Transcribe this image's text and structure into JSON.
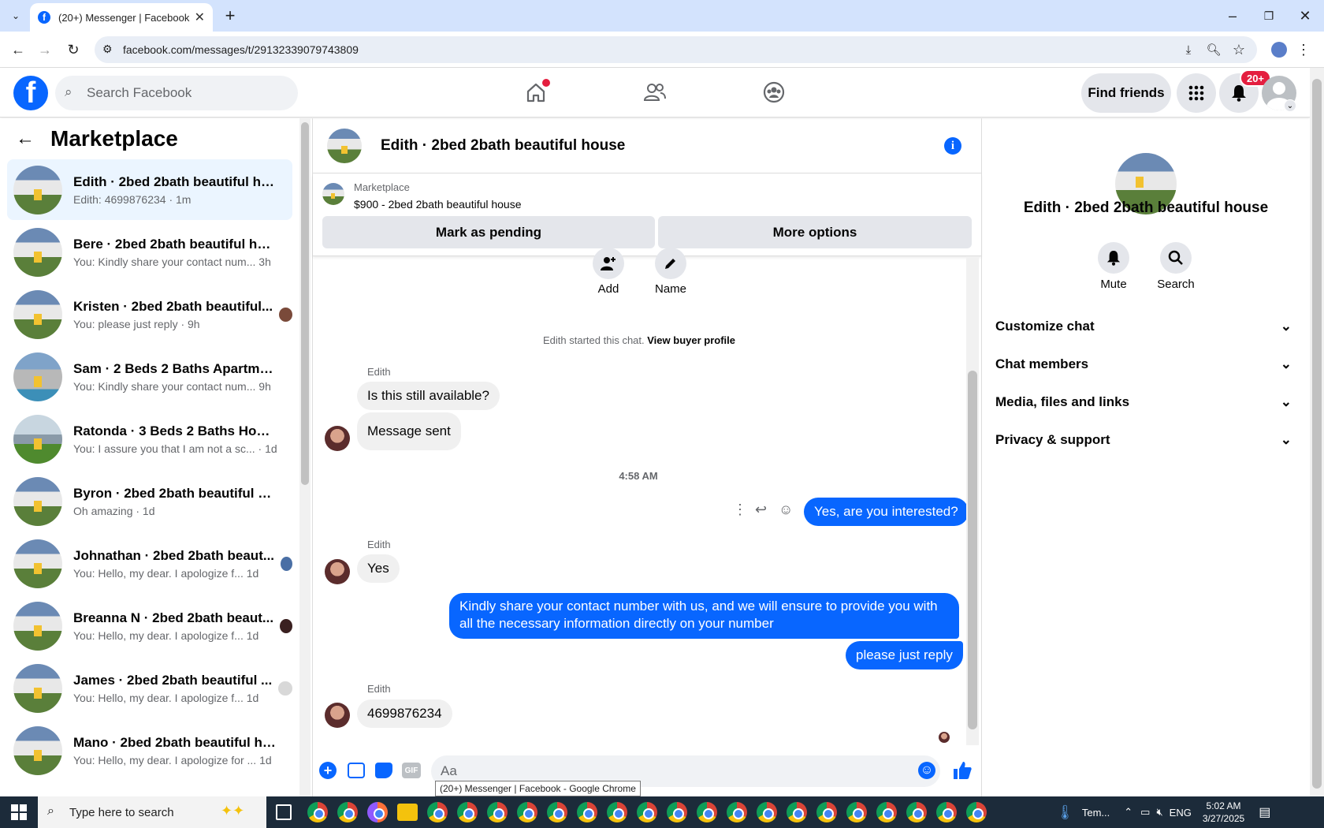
{
  "browser": {
    "tab_title": "(20+) Messenger | Facebook",
    "url": "facebook.com/messages/t/29132339079743809",
    "new_tab": "+"
  },
  "facebook": {
    "logo": "f",
    "search_placeholder": "Search Facebook",
    "find_friends": "Find friends",
    "notification_badge": "20+"
  },
  "sidebar": {
    "title": "Marketplace",
    "conversations": [
      {
        "name": "Edith · 2bed 2bath beautiful hou...",
        "preview": "Edith: 4699876234 · 1m",
        "time": ""
      },
      {
        "name": "Bere · 2bed 2bath beautiful house",
        "preview": "You: Kindly share your contact num...",
        "time": "3h"
      },
      {
        "name": "Kristen · 2bed 2bath beautiful...",
        "preview": "You: please just reply · 9h",
        "time": ""
      },
      {
        "name": "Sam · 2 Beds 2 Baths Apartment...",
        "preview": "You: Kindly share your contact num...",
        "time": "9h"
      },
      {
        "name": "Ratonda · 3 Beds 2 Baths House",
        "preview": "You: I assure you that I am not a sc...",
        "time": "· 1d"
      },
      {
        "name": "Byron · 2bed 2bath beautiful ho...",
        "preview": "Oh amazing · 1d",
        "time": ""
      },
      {
        "name": "Johnathan · 2bed 2bath beaut...",
        "preview": "You: Hello, my dear. I apologize f...",
        "time": "1d"
      },
      {
        "name": "Breanna N · 2bed 2bath beaut...",
        "preview": "You: Hello, my dear. I apologize f...",
        "time": "1d"
      },
      {
        "name": "James · 2bed 2bath beautiful ...",
        "preview": "You: Hello, my dear. I apologize f...",
        "time": "1d"
      },
      {
        "name": "Mano · 2bed 2bath beautiful ho...",
        "preview": "You: Hello, my dear. I apologize for ...",
        "time": "1d"
      }
    ]
  },
  "chat": {
    "title": "Edith · 2bed 2bath beautiful house",
    "listing_source": "Marketplace",
    "listing_desc": "$900 - 2bed 2bath beautiful house",
    "mark_pending": "Mark as pending",
    "more_options": "More options",
    "add_label": "Add",
    "name_label": "Name",
    "started_text": "Edith started this chat.",
    "view_profile": "View buyer profile",
    "sender_name": "Edith",
    "msg1": "Is this still available?",
    "msg2": "Message sent",
    "timestamp": "4:58 AM",
    "out1": "Yes, are you interested?",
    "msg3": "Yes",
    "out2": "Kindly share your contact number with us, and we will ensure to provide you with all the necessary information directly on your number",
    "out3": "please just reply",
    "msg4": "4699876234",
    "input_placeholder": "Aa",
    "gif_label": "GIF",
    "tooltip": "(20+) Messenger | Facebook - Google Chrome"
  },
  "details": {
    "title": "Edith · 2bed 2bath beautiful house",
    "mute": "Mute",
    "search": "Search",
    "sections": [
      "Customize chat",
      "Chat members",
      "Media, files and links",
      "Privacy & support"
    ]
  },
  "taskbar": {
    "search_placeholder": "Type here to search",
    "weather": "Tem...",
    "lang": "ENG",
    "time": "5:02 AM",
    "date": "3/27/2025"
  }
}
